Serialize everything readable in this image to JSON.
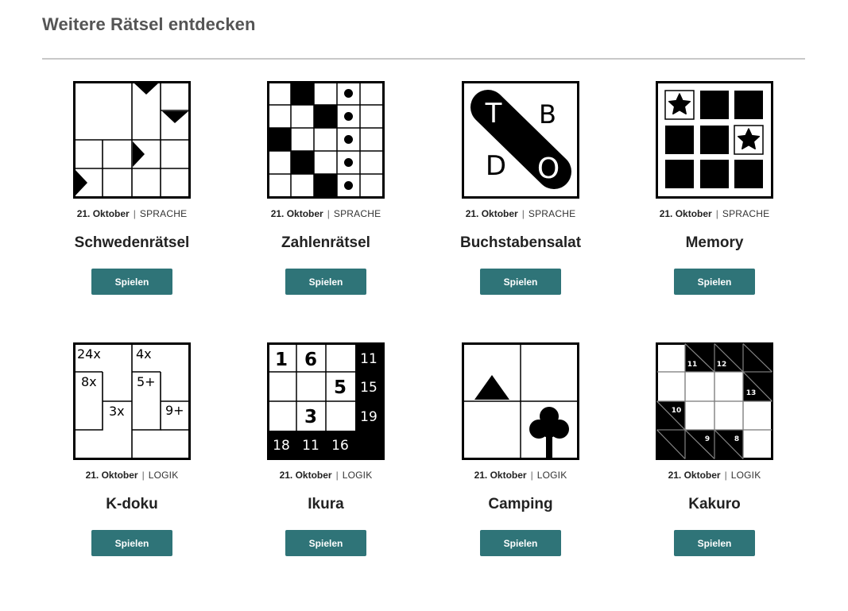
{
  "page": {
    "title": "Weitere Rätsel entdecken"
  },
  "puzzles": [
    {
      "date": "21. Oktober",
      "category": "SPRACHE",
      "name": "Schwedenrätsel",
      "button": "Spielen",
      "icon": "schwedenraetsel-icon"
    },
    {
      "date": "21. Oktober",
      "category": "SPRACHE",
      "name": "Zahlenrätsel",
      "button": "Spielen",
      "icon": "zahlenraetsel-icon"
    },
    {
      "date": "21. Oktober",
      "category": "SPRACHE",
      "name": "Buchstabensalat",
      "button": "Spielen",
      "icon": "buchstabensalat-icon",
      "icon_letters": [
        "T",
        "B",
        "D",
        "O"
      ]
    },
    {
      "date": "21. Oktober",
      "category": "SPRACHE",
      "name": "Memory",
      "button": "Spielen",
      "icon": "memory-icon"
    },
    {
      "date": "21. Oktober",
      "category": "LOGIK",
      "name": "K-doku",
      "button": "Spielen",
      "icon": "kdoku-icon",
      "icon_labels": [
        "24x",
        "4x",
        "8x",
        "5+",
        "3x",
        "9+"
      ]
    },
    {
      "date": "21. Oktober",
      "category": "LOGIK",
      "name": "Ikura",
      "button": "Spielen",
      "icon": "ikura-icon",
      "icon_labels": [
        "1",
        "6",
        "5",
        "3",
        "11",
        "15",
        "19",
        "18",
        "11",
        "16"
      ]
    },
    {
      "date": "21. Oktober",
      "category": "LOGIK",
      "name": "Camping",
      "button": "Spielen",
      "icon": "camping-icon"
    },
    {
      "date": "21. Oktober",
      "category": "LOGIK",
      "name": "Kakuro",
      "button": "Spielen",
      "icon": "kakuro-icon",
      "icon_labels": [
        "11",
        "12",
        "13",
        "10",
        "9",
        "8"
      ]
    }
  ]
}
